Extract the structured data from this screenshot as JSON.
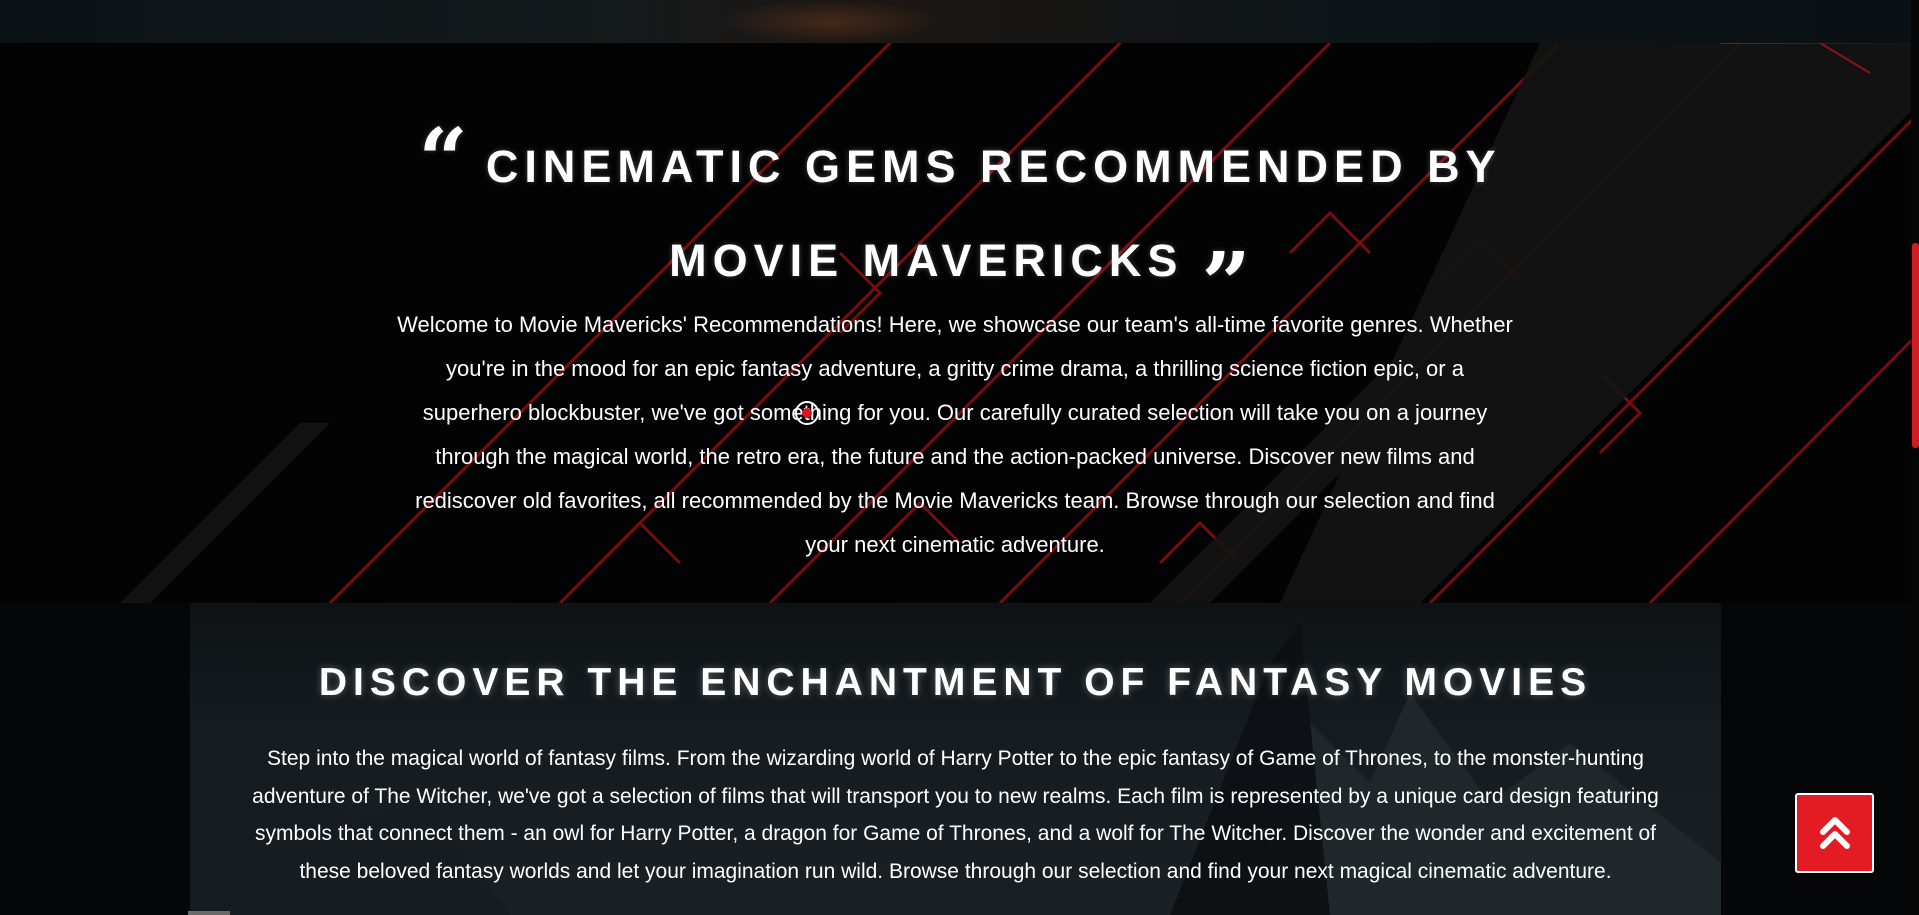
{
  "intro": {
    "open_quote": "“",
    "title": "CINEMATIC GEMS RECOMMENDED BY MOVIE MAVERICKS",
    "close_quote": "”",
    "text": "Welcome to Movie Mavericks' Recommendations! Here, we showcase our team's all-time favorite genres. Whether you're in the mood for an epic fantasy adventure, a gritty crime drama, a thrilling science fiction epic, or a superhero blockbuster, we've got something for you. Our carefully curated selection will take you on a journey through the magical world, the retro era, the future and the action-packed universe. Discover new films and rediscover old favorites, all recommended by the Movie Mavericks team. Browse through our selection and find your next cinematic adventure."
  },
  "fantasy": {
    "heading": "DISCOVER THE ENCHANTMENT OF FANTASY MOVIES",
    "text": "Step into the magical world of fantasy films. From the wizarding world of Harry Potter to the epic fantasy of Game of Thrones, to the monster-hunting adventure of The Witcher, we've got a selection of films that will transport you to new realms. Each film is represented by a unique card design featuring symbols that connect them - an owl for Harry Potter, a dragon for Game of Thrones, and a wolf for The Witcher. Discover the wonder and excitement of these beloved fantasy worlds and let your imagination run wild. Browse through our selection and find your next magical cinematic adventure."
  },
  "back_to_top": {
    "icon": "double-chevron-up-icon"
  },
  "colors": {
    "accent": "#e41b22",
    "background": "#030303",
    "text": "#ffffff"
  }
}
